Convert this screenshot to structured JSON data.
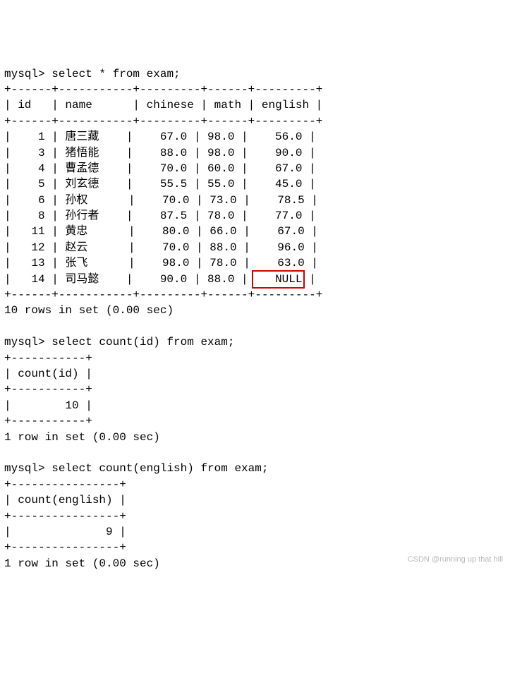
{
  "query1": {
    "prompt": "mysql> ",
    "sql": "select * from exam;",
    "headers": [
      "id",
      "name",
      "chinese",
      "math",
      "english"
    ],
    "rows": [
      {
        "id": "1",
        "name": "唐三藏",
        "chinese": "67.0",
        "math": "98.0",
        "english": "56.0"
      },
      {
        "id": "3",
        "name": "猪悟能",
        "chinese": "88.0",
        "math": "98.0",
        "english": "90.0"
      },
      {
        "id": "4",
        "name": "曹孟德",
        "chinese": "70.0",
        "math": "60.0",
        "english": "67.0"
      },
      {
        "id": "5",
        "name": "刘玄德",
        "chinese": "55.5",
        "math": "55.0",
        "english": "45.0"
      },
      {
        "id": "6",
        "name": "孙权",
        "chinese": "70.0",
        "math": "73.0",
        "english": "78.5"
      },
      {
        "id": "8",
        "name": "孙行者",
        "chinese": "87.5",
        "math": "78.0",
        "english": "77.0"
      },
      {
        "id": "11",
        "name": "黄忠",
        "chinese": "80.0",
        "math": "66.0",
        "english": "67.0"
      },
      {
        "id": "12",
        "name": "赵云",
        "chinese": "70.0",
        "math": "88.0",
        "english": "96.0"
      },
      {
        "id": "13",
        "name": "张飞",
        "chinese": "98.0",
        "math": "78.0",
        "english": "63.0"
      },
      {
        "id": "14",
        "name": "司马懿",
        "chinese": "90.0",
        "math": "88.0",
        "english": "NULL"
      }
    ],
    "border": "+------+-----------+---------+------+---------+",
    "status": "10 rows in set (0.00 sec)"
  },
  "query2": {
    "prompt": "mysql> ",
    "sql": "select count(id) from exam;",
    "header": "count(id)",
    "value": "10",
    "border": "+-----------+",
    "status": "1 row in set (0.00 sec)"
  },
  "query3": {
    "prompt": "mysql> ",
    "sql": "select count(english) from exam;",
    "header": "count(english)",
    "value": "9",
    "border": "+----------------+",
    "status": "1 row in set (0.00 sec)"
  },
  "watermark": "CSDN @running up that hill"
}
